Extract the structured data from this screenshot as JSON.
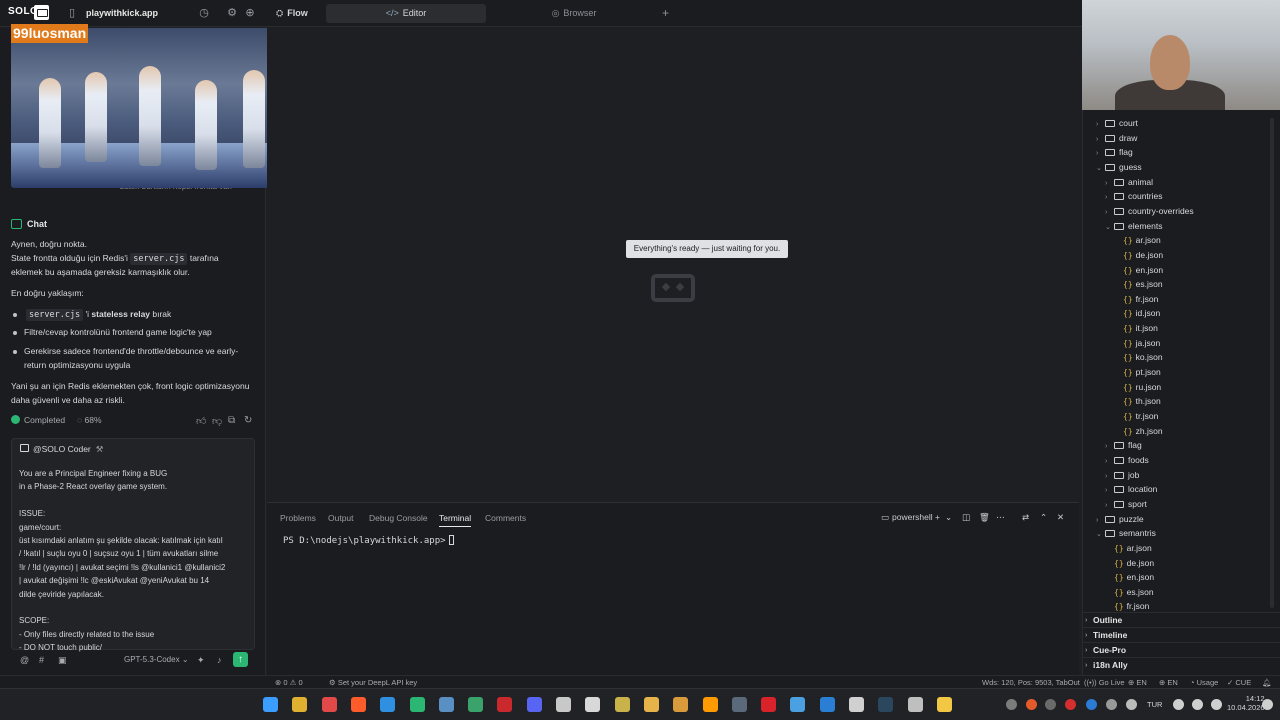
{
  "titlebar": {
    "brand": "SOLO",
    "workspace": "playwithkick.app",
    "tabs": {
      "flow": "Flow",
      "editor": "Editor",
      "browser": "Browser"
    }
  },
  "video_overlay": {
    "streamer_name": "99luosman"
  },
  "left_panel": {
    "prev_message": "zaten bunların hepsi frontta var.",
    "chat_title": "Chat",
    "answer": {
      "p1_line1": "Aynen, doğru nokta.",
      "p1_line2a": "State frontta olduğu için Redis'i ",
      "p1_code": "server.cjs",
      "p1_line2b": " tarafına",
      "p1_line3": "eklemek bu aşamada gereksiz karmaşıklık olur.",
      "p2": "En doğru yaklaşım:",
      "b1_code": "server.cjs",
      "b1_text_a": " 'i ",
      "b1_bold": "stateless relay",
      "b1_text_b": " bırak",
      "b2": "Filtre/cevap kontrolünü frontend game logic'te yap",
      "b3_line1": "Gerekirse sadece frontend'de throttle/debounce ve early-",
      "b3_line2": "return optimizasyonu uygula",
      "p3_line1": "Yani şu an için Redis eklemekten çok, front logic optimizasyonu",
      "p3_line2": "daha güvenli ve daha az riskli."
    },
    "status": {
      "label": "Completed",
      "progress": "68%"
    },
    "composer": {
      "agent": "@SOLO Coder",
      "text": "You are a Principal Engineer fixing a BUG\nin a Phase-2 React overlay game system.\n\nISSUE:\ngame/court:\nüst kısımdaki anlatım şu şekilde olacak: katılmak için katıl\n/ !katıl | suçlu oyu 0 | suçsuz oyu 1 | tüm avukatları silme\n!lr / !ld (yayıncı) | avukat seçimi !ls @kullanici1 @kullanici2\n| avukat değişimi !lc @eskiAvukat @yeniAvukat bu 14\ndilde çeviride yapılacak.\n\nSCOPE:\n- Only files directly related to the issue\n- DO NOT touch public/",
      "model": "GPT-5.3-Codex"
    }
  },
  "editor": {
    "tooltip": "Everything's ready — just waiting for you."
  },
  "terminal": {
    "tabs": [
      "Problems",
      "Output",
      "Debug Console",
      "Terminal",
      "Comments"
    ],
    "active_tab": "Terminal",
    "shell": "powershell",
    "prompt": "PS D:\\nodejs\\playwithkick.app>"
  },
  "explorer": {
    "items": [
      {
        "label": "court",
        "type": "folder",
        "depth": 1
      },
      {
        "label": "draw",
        "type": "folder",
        "depth": 1
      },
      {
        "label": "flag",
        "type": "folder",
        "depth": 1
      },
      {
        "label": "guess",
        "type": "folder-open",
        "depth": 1
      },
      {
        "label": "animal",
        "type": "folder",
        "depth": 2
      },
      {
        "label": "countries",
        "type": "folder",
        "depth": 2
      },
      {
        "label": "country-overrides",
        "type": "folder",
        "depth": 2
      },
      {
        "label": "elements",
        "type": "folder-open",
        "depth": 2
      },
      {
        "label": "ar.json",
        "type": "json",
        "depth": 3
      },
      {
        "label": "de.json",
        "type": "json",
        "depth": 3
      },
      {
        "label": "en.json",
        "type": "json",
        "depth": 3
      },
      {
        "label": "es.json",
        "type": "json",
        "depth": 3
      },
      {
        "label": "fr.json",
        "type": "json",
        "depth": 3
      },
      {
        "label": "id.json",
        "type": "json",
        "depth": 3
      },
      {
        "label": "it.json",
        "type": "json",
        "depth": 3
      },
      {
        "label": "ja.json",
        "type": "json",
        "depth": 3
      },
      {
        "label": "ko.json",
        "type": "json",
        "depth": 3
      },
      {
        "label": "pt.json",
        "type": "json",
        "depth": 3
      },
      {
        "label": "ru.json",
        "type": "json",
        "depth": 3
      },
      {
        "label": "th.json",
        "type": "json",
        "depth": 3
      },
      {
        "label": "tr.json",
        "type": "json",
        "depth": 3
      },
      {
        "label": "zh.json",
        "type": "json",
        "depth": 3
      },
      {
        "label": "flag",
        "type": "folder",
        "depth": 2
      },
      {
        "label": "foods",
        "type": "folder",
        "depth": 2
      },
      {
        "label": "job",
        "type": "folder",
        "depth": 2
      },
      {
        "label": "location",
        "type": "folder",
        "depth": 2
      },
      {
        "label": "sport",
        "type": "folder",
        "depth": 2
      },
      {
        "label": "puzzle",
        "type": "folder",
        "depth": 1
      },
      {
        "label": "semantris",
        "type": "folder-open",
        "depth": 1
      },
      {
        "label": "ar.json",
        "type": "json",
        "depth": 2
      },
      {
        "label": "de.json",
        "type": "json",
        "depth": 2
      },
      {
        "label": "en.json",
        "type": "json",
        "depth": 2
      },
      {
        "label": "es.json",
        "type": "json",
        "depth": 2
      },
      {
        "label": "fr.json",
        "type": "json",
        "depth": 2
      }
    ],
    "sections": [
      "Outline",
      "Timeline",
      "Cue-Pro",
      "i18n Ally"
    ]
  },
  "statusbar": {
    "errors": "0",
    "warnings": "0",
    "deepl": "Set your DeepL API key",
    "position": "Wds: 120, Pos: 9503, TabOut",
    "go_live": "Go Live",
    "lang1": "EN",
    "lang2": "EN",
    "usage": "Usage",
    "cue": "CUE"
  },
  "taskbar": {
    "lang": "TUR",
    "time": "14:12",
    "date": "10.04.2026"
  },
  "colors": {
    "accent": "#2bb673",
    "background": "#1e1f22",
    "overlay_name_bg": "#e07a1a"
  }
}
